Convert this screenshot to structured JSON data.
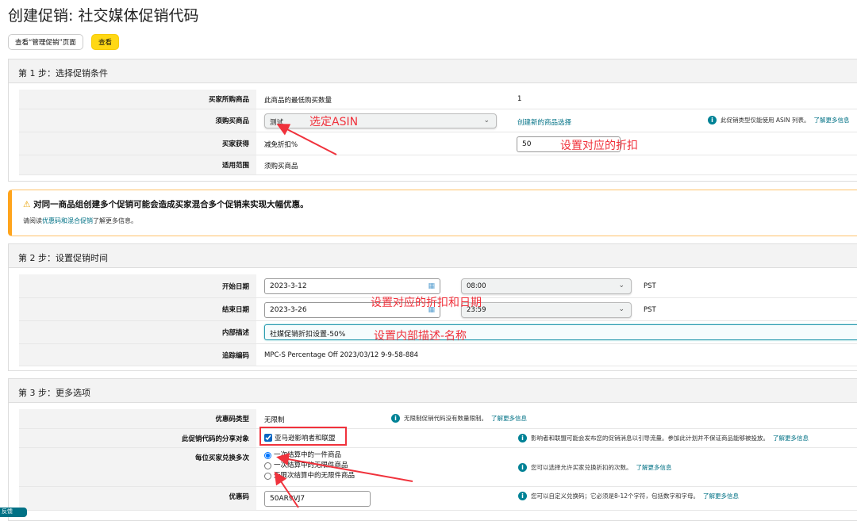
{
  "title": "创建促销: 社交媒体促销代码",
  "buttons": {
    "view_manage": "查看“管理促销”页面",
    "view": "查看"
  },
  "step1": {
    "header": "第 1 步：选择促销条件",
    "rows": [
      {
        "label": "买家所购商品",
        "value": "此商品的最低购买数量",
        "extra": "1"
      },
      {
        "label": "须购买商品",
        "select": "测试",
        "link": "创建新的商品选择",
        "info": "此促销类型仅能使用 ASIN 列表。",
        "more": "了解更多信息"
      },
      {
        "label": "买家获得",
        "value": "减免折扣%",
        "input": "50"
      },
      {
        "label": "适用范围",
        "value": "须购买商品"
      }
    ]
  },
  "warning": {
    "title": "对同一商品组创建多个促销可能会造成买家混合多个促销来实现大幅优惠。",
    "pre": "请阅读",
    "link": "优惠码和混合促销",
    "post": "了解更多信息。"
  },
  "step2": {
    "header": "第 2 步：设置促销时间",
    "start": {
      "label": "开始日期",
      "date": "2023-3-12",
      "time": "08:00",
      "tz": "PST"
    },
    "end": {
      "label": "结束日期",
      "date": "2023-3-26",
      "time": "23:59",
      "tz": "PST"
    },
    "desc": {
      "label": "内部描述",
      "value": "社媒促销折扣设置-50%"
    },
    "tracking": {
      "label": "追踪编码",
      "value": "MPC-S Percentage Off 2023/03/12 9-9-58-884"
    }
  },
  "step3": {
    "header": "第 3 步：更多选项",
    "type": {
      "label": "优惠码类型",
      "value": "无限制",
      "info": "无限制促销代码没有数量限制。",
      "more": "了解更多信息"
    },
    "share": {
      "label": "此促销代码的分享对象",
      "checkbox": "亚马逊影响者和联盟",
      "checked": true,
      "info": "影响者和联盟可能会发布您的促销消息以引导流量。参加此计划并不保证商品能够被投放。",
      "more": "了解更多信息"
    },
    "redeem": {
      "label": "每位买家兑换多次",
      "options": [
        "一次结算中的一件商品",
        "一次结算中的无限件商品",
        "无限次结算中的无限件商品"
      ],
      "selected": 0,
      "info": "您可以选择允许买家兑换折扣的次数。",
      "more": "了解更多信息"
    },
    "code": {
      "label": "优惠码",
      "value": "50AR9VJ7",
      "info": "您可以自定义兑换码；它必须是8-12个字符，包括数字和字母。",
      "more": "了解更多信息"
    }
  },
  "annotations": [
    "选定ASIN",
    "设置对应的折扣",
    "设置对应的折扣和日期",
    "设置内部描述-名称"
  ],
  "feedback": "反馈",
  "colors": {
    "accent": "#ffd814",
    "annotation": "#f0323c",
    "link": "#007185",
    "warning": "#ffa41c"
  }
}
